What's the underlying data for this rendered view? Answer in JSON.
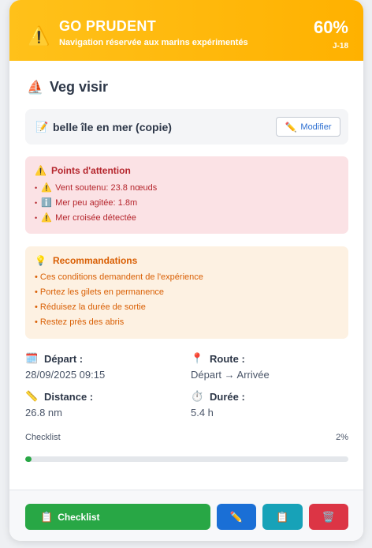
{
  "header": {
    "warning_icon": "⚠️",
    "status": "GO PRUDENT",
    "subtitle": "Navigation réservée aux marins expérimentés",
    "score": "60%",
    "countdown": "J-18",
    "color": "#ffb100"
  },
  "boat": {
    "icon": "⛵",
    "name": "Veg visir"
  },
  "route": {
    "icon": "📝",
    "name": "belle île en mer (copie)",
    "edit_icon": "✏️",
    "edit_label": "Modifier"
  },
  "alerts": {
    "icon": "⚠️",
    "title": "Points d'attention",
    "bullet": "•",
    "items": [
      {
        "icon": "⚠️",
        "text": "Vent soutenu: 23.8 nœuds"
      },
      {
        "icon": "ℹ️",
        "text": "Mer peu agitée: 1.8m"
      },
      {
        "icon": "⚠️",
        "text": "Mer croisée détectée"
      }
    ]
  },
  "recommendations": {
    "icon": "💡",
    "title": "Recommandations",
    "items": [
      "• Ces conditions demandent de l'expérience",
      "• Portez les gilets en permanence",
      "• Réduisez la durée de sortie",
      "• Restez près des abris"
    ]
  },
  "details": {
    "departure": {
      "icon": "🗓️",
      "label": "Départ :",
      "value": "28/09/2025 09:15"
    },
    "route": {
      "icon": "📍",
      "label": "Route :",
      "value": "Départ → Arrivée"
    },
    "distance": {
      "icon": "📏",
      "label": "Distance :",
      "value": "26.8 nm"
    },
    "duration": {
      "icon": "⏱️",
      "label": "Durée :",
      "value": "5.4 h"
    }
  },
  "checklist_progress": {
    "label": "Checklist",
    "percent_text": "2%",
    "fraction": 0.02
  },
  "footer": {
    "checklist_icon": "📋",
    "checklist_label": "Checklist",
    "edit_icon": "✏️",
    "copy_icon": "📋",
    "delete_icon": "🗑️"
  }
}
